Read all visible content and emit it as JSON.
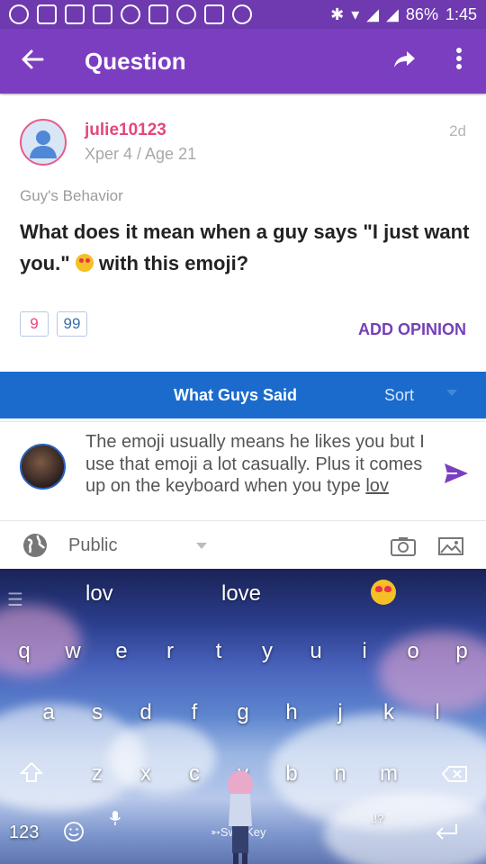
{
  "status_bar": {
    "battery": "86%",
    "time": "1:45"
  },
  "app_bar": {
    "title": "Question"
  },
  "question": {
    "username": "julie10123",
    "user_info": "Xper 4 / Age 21",
    "age": "2d",
    "category": "Guy's Behavior",
    "text_part1": "What does it mean when a guy says \"I just want you.\" ",
    "text_part2": " with this emoji?",
    "badge_count_1": "9",
    "badge_count_2": "99",
    "add_opinion": "ADD OPINION"
  },
  "opinions_bar": {
    "title": "What Guys Said",
    "sort_label": "Sort"
  },
  "reply": {
    "text": "The emoji usually means he likes you but I use that emoji a lot casually. Plus it comes up on the keyboard when you type ",
    "underlined_word": "lov"
  },
  "visibility": {
    "label": "Public"
  },
  "keyboard": {
    "suggestions": [
      "lov",
      "love"
    ],
    "row1": [
      "q",
      "w",
      "e",
      "r",
      "t",
      "y",
      "u",
      "i",
      "o",
      "p"
    ],
    "row2": [
      "a",
      "s",
      "d",
      "f",
      "g",
      "h",
      "j",
      "k",
      "l"
    ],
    "row3": [
      "z",
      "x",
      "c",
      "v",
      "b",
      "n",
      "m"
    ],
    "numbers_key": "123",
    "brand": "SwiftKey",
    "punct_key": ".!?"
  },
  "colors": {
    "primary": "#7b3ec0",
    "blue_bar": "#1b6bcc",
    "username": "#e4477c",
    "accent": "#7440b8"
  }
}
